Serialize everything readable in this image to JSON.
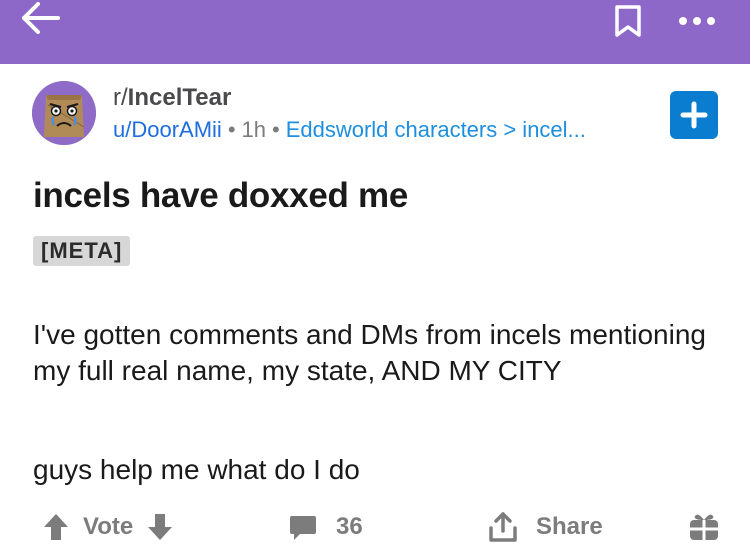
{
  "topbar": {
    "background_color": "#8e68c9",
    "back_icon": "arrow-left-icon",
    "bookmark_icon": "bookmark-icon",
    "more_icon": "more-horizontal-icon"
  },
  "post": {
    "subreddit_prefix": "r/",
    "subreddit_name": "IncelTear",
    "author": "u/DoorAMii",
    "age": "1h",
    "flair": "Eddsworld characters > incel...",
    "title": "incels have doxxed me",
    "tag": "[META]",
    "body_paragraphs": [
      "I've gotten comments and DMs from incels mentioning my full real name, my state, AND MY CITY",
      "guys help me what do I do"
    ],
    "join_icon": "plus-icon",
    "avatar_icon": "paper-bag-avatar-icon"
  },
  "actions": {
    "vote_label": "Vote",
    "comment_count": "36",
    "share_label": "Share",
    "upvote_icon": "arrow-up-icon",
    "downvote_icon": "arrow-down-icon",
    "comment_icon": "comment-icon",
    "share_icon": "share-icon",
    "award_icon": "gift-icon"
  }
}
